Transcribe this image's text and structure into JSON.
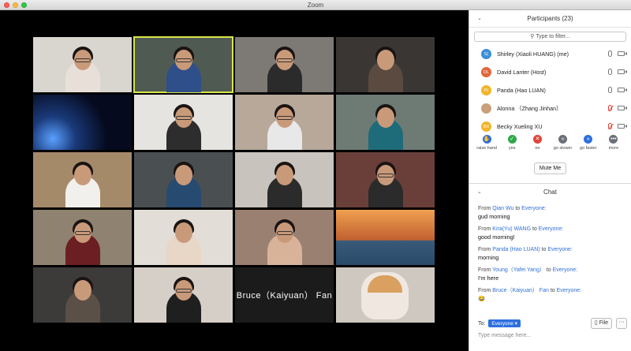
{
  "window": {
    "title": "Zoom"
  },
  "gallery": {
    "tiles": [
      {
        "id": "t1",
        "bg": "#d9d6d0",
        "person": "#e8e0d8",
        "glasses": true
      },
      {
        "id": "t2",
        "bg": "#4f5a52",
        "person": "#2f4f8a",
        "glasses": true
      },
      {
        "id": "t3",
        "bg": "#7d7a76",
        "person": "#2b2b2b",
        "glasses": true
      },
      {
        "id": "t4",
        "bg": "#3a3634",
        "person": "#5a4a40",
        "glasses": false
      },
      {
        "id": "t5",
        "bg": "#0d1a3a",
        "person": null,
        "glasses": false
      },
      {
        "id": "t6",
        "bg": "#e6e4e0",
        "person": "#2d2d2d",
        "glasses": true
      },
      {
        "id": "t7",
        "bg": "#b7a89a",
        "person": "#e8e8e8",
        "glasses": true
      },
      {
        "id": "t8",
        "bg": "#6e7a74",
        "person": "#1e6b7a",
        "glasses": false
      },
      {
        "id": "t9",
        "bg": "#a58a6a",
        "person": "#f2f0ec",
        "glasses": false
      },
      {
        "id": "t10",
        "bg": "#4a4f52",
        "person": "#274b70",
        "glasses": false
      },
      {
        "id": "t11",
        "bg": "#c9c3bd",
        "person": "#2b2b2b",
        "glasses": false
      },
      {
        "id": "t12",
        "bg": "#6a3f3a",
        "person": "#2b2b2b",
        "glasses": true
      },
      {
        "id": "t13",
        "bg": "#8f8270",
        "person": "#6b1f22",
        "glasses": true
      },
      {
        "id": "t14",
        "bg": "#e2ddd6",
        "person": "#e8d6c6",
        "glasses": false
      },
      {
        "id": "t15",
        "bg": "#9a8070",
        "person": "#d8b39a",
        "glasses": true
      },
      {
        "id": "t16",
        "bg": "#c67a3a",
        "person": null,
        "glasses": false
      },
      {
        "id": "t17",
        "bg": "#3d3b3a",
        "person": "#5a5048",
        "glasses": false
      },
      {
        "id": "t18",
        "bg": "#d6cfc8",
        "person": "#1f1f1f",
        "glasses": true
      },
      {
        "id": "t19",
        "bg": "#1b1b1b",
        "person": null,
        "glasses": false,
        "name": "Bruce（Kaiyuan） Fan"
      },
      {
        "id": "t20",
        "bg": "#cfc8c0",
        "person": null,
        "glasses": false
      }
    ]
  },
  "participants": {
    "header": "Participants (23)",
    "search_placeholder": "Type to filter...",
    "list": [
      {
        "initials": "S(",
        "color": "#3a8fd6",
        "name": "Shirley (Xiaoli HUANG) (me)",
        "muted": false
      },
      {
        "initials": "DL",
        "color": "#e0663a",
        "name": "David Lanter (Host)",
        "muted": false
      },
      {
        "initials": "P(",
        "color": "#f0b52c",
        "name": "Panda (Hao LUAN)",
        "muted": false
      },
      {
        "initials": "",
        "color": "#c9a07a",
        "name": "Alonna （Zhang Jinhan）",
        "muted": true
      },
      {
        "initials": "BX",
        "color": "#f0b52c",
        "name": "Becky Xueling XU",
        "muted": true
      }
    ],
    "reactions": [
      {
        "label": "raise hand",
        "icon": "✋",
        "color": "#2d6fe0",
        "name": "raise-hand"
      },
      {
        "label": "yes",
        "icon": "✓",
        "color": "#2fa84a",
        "name": "yes"
      },
      {
        "label": "no",
        "icon": "✕",
        "color": "#e0443a",
        "name": "no"
      },
      {
        "label": "go slower",
        "icon": "«",
        "color": "#6a6f7a",
        "name": "go-slower"
      },
      {
        "label": "go faster",
        "icon": "»",
        "color": "#2d6fe0",
        "name": "go-faster"
      },
      {
        "label": "more",
        "icon": "•••",
        "color": "#6a6f7a",
        "name": "more"
      }
    ],
    "mute_me": "Mute Me"
  },
  "chat": {
    "header": "Chat",
    "messages": [
      {
        "from_prefix": "From ",
        "sender": "Qian Wu",
        "to_prefix": " to ",
        "recipient": "Everyone:",
        "text": "gud morning"
      },
      {
        "from_prefix": "From ",
        "sender": "Kira(Yu) WANG",
        "to_prefix": " to ",
        "recipient": "Everyone:",
        "text": "good morning!"
      },
      {
        "from_prefix": "From ",
        "sender": "Panda (Hao LUAN)",
        "to_prefix": " to ",
        "recipient": "Everyone:",
        "text": "morning"
      },
      {
        "from_prefix": "From ",
        "sender": "Young（Yafei Yang）",
        "to_prefix": " to ",
        "recipient": "Everyone:",
        "text": "I'm here"
      },
      {
        "from_prefix": "From ",
        "sender": "Bruce（Kaiyuan） Fan",
        "to_prefix": " to ",
        "recipient": "Everyone:",
        "text": "😂"
      }
    ],
    "to_label": "To:",
    "to_value": "Everyone",
    "file_button": "File",
    "more_button": "···",
    "compose_placeholder": "Type message here..."
  }
}
